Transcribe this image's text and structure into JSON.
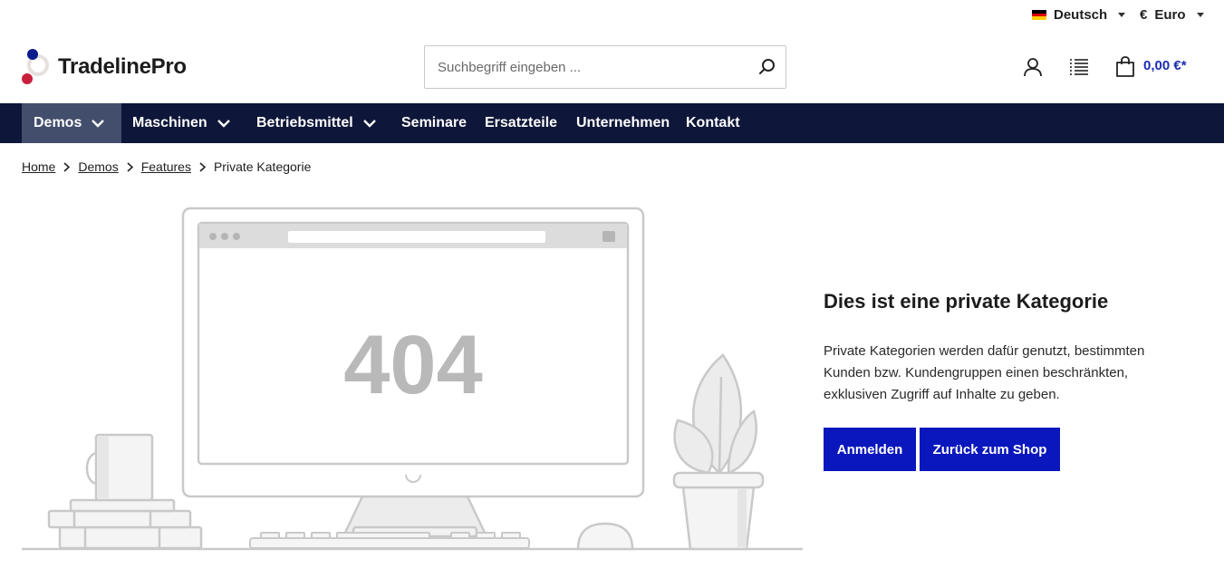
{
  "topbar": {
    "language": {
      "label": "Deutsch",
      "flag_colors": [
        "#000000",
        "#dd0000",
        "#ffce00"
      ]
    },
    "currency": {
      "symbol": "€",
      "label": "Euro"
    }
  },
  "header": {
    "logo_text": "TradelinePro",
    "search": {
      "placeholder": "Suchbegriff eingeben ...",
      "value": ""
    },
    "icons": [
      "user-icon",
      "list-icon",
      "cart-icon"
    ],
    "cart_total": "0,00 €*"
  },
  "nav": {
    "items": [
      {
        "label": "Demos",
        "dropdown": true,
        "active": true
      },
      {
        "label": "Maschinen",
        "dropdown": true
      },
      {
        "label": "Betriebsmittel",
        "dropdown": true
      },
      {
        "label": "Seminare"
      },
      {
        "label": "Ersatzteile"
      },
      {
        "label": "Unternehmen"
      },
      {
        "label": "Kontakt"
      }
    ]
  },
  "breadcrumb": {
    "items": [
      "Home",
      "Demos",
      "Features"
    ],
    "current": "Private Kategorie"
  },
  "illustration": {
    "code": "404"
  },
  "content": {
    "title": "Dies ist eine private Kategorie",
    "text": "Private Kategorien werden dafür genutzt, bestimmten Kunden bzw. Kundengruppen einen beschränkten, exklusiven Zugriff auf Inhalte zu geben.",
    "login_button": "Anmelden",
    "back_button": "Zurück zum Shop"
  },
  "colors": {
    "nav_bg": "#0e1639",
    "nav_active": "#434d6c",
    "primary": "#0a17bd",
    "price": "#1a2bb0"
  }
}
